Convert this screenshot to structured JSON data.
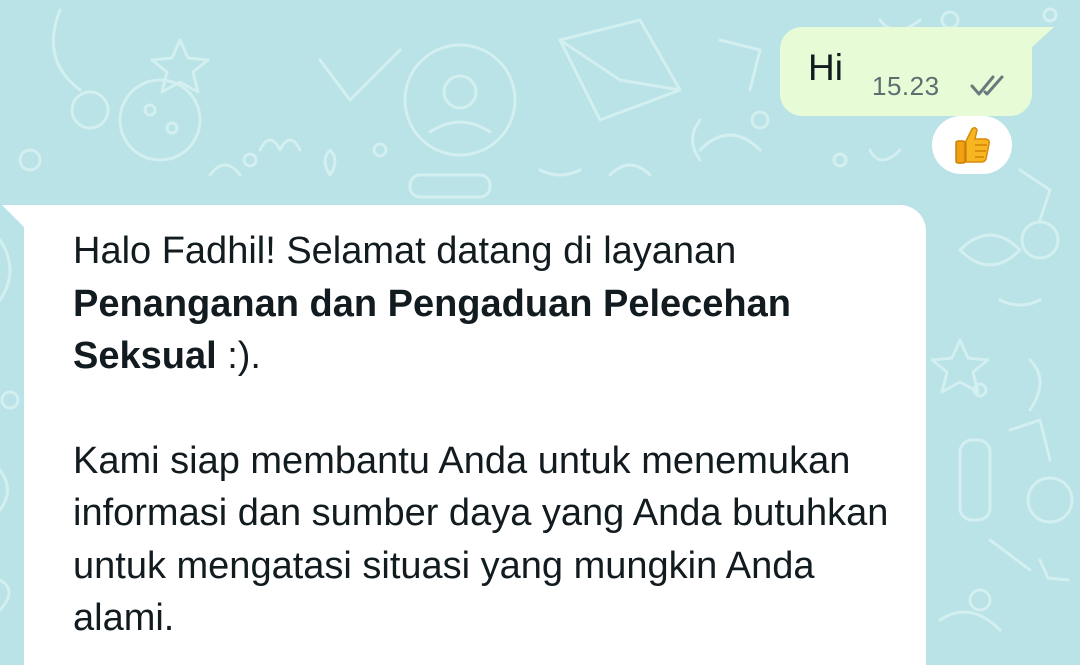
{
  "chat": {
    "outgoing": {
      "text": "Hi",
      "time": "15.23",
      "status_icon": "double-check-icon",
      "reaction": "thumbs-up"
    },
    "incoming": {
      "line1_a": "Halo Fadhil! Selamat datang di layanan",
      "line1_bold": "Penanganan dan Pengaduan Pelecehan Seksual",
      "line1_c": " :).",
      "para2": "Kami siap membantu Anda untuk menemukan informasi dan sumber daya yang Anda butuhkan untuk mengatasi situasi yang mungkin Anda alami."
    }
  },
  "colors": {
    "wallpaper": "#b9e3e6",
    "outgoing_bubble": "#e7fcd6",
    "incoming_bubble": "#ffffff"
  }
}
